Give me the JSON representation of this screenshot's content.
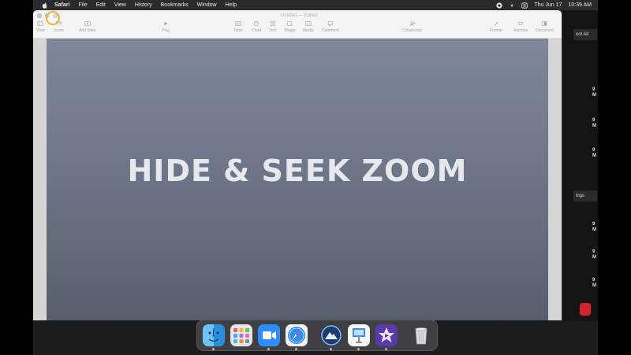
{
  "menubar": {
    "app_name": "Safari",
    "items": [
      "File",
      "Edit",
      "View",
      "History",
      "Bookmarks",
      "Window",
      "Help"
    ],
    "date": "Thu Jun 17",
    "time": "10:39 AM"
  },
  "window": {
    "title": "Untitled",
    "subtitle": "— Edited"
  },
  "toolbar": {
    "view": "View",
    "zoom": "Zoom",
    "zoom_value": "75%",
    "add_slide": "Add Slide",
    "play": "Play",
    "table": "Table",
    "chart": "Chart",
    "text": "Text",
    "shape": "Shape",
    "media": "Media",
    "comment": "Comment",
    "collaborate": "Collaborate",
    "format": "Format",
    "animate": "Animate",
    "document": "Document"
  },
  "slide": {
    "title": "HIDE & SEEK ZOOM"
  },
  "background_window": {
    "tab1": "ool All",
    "tab2": "ings",
    "m_letters": [
      "9",
      "M",
      "9",
      "M",
      "9",
      "M",
      "9",
      "M",
      "9",
      "M",
      "9",
      "M"
    ]
  },
  "dock": {
    "apps": [
      "finder-app",
      "launchpad-app",
      "zoom-app",
      "safari-app",
      "cleanmymac-app",
      "keynote-app",
      "imovie-app",
      "trash-app"
    ]
  },
  "colors": {
    "slide_top": "#7e879b",
    "slide_bottom": "#575e6e",
    "cursor_ring": "#e7b53a",
    "menubar": "#2b2b2d"
  }
}
